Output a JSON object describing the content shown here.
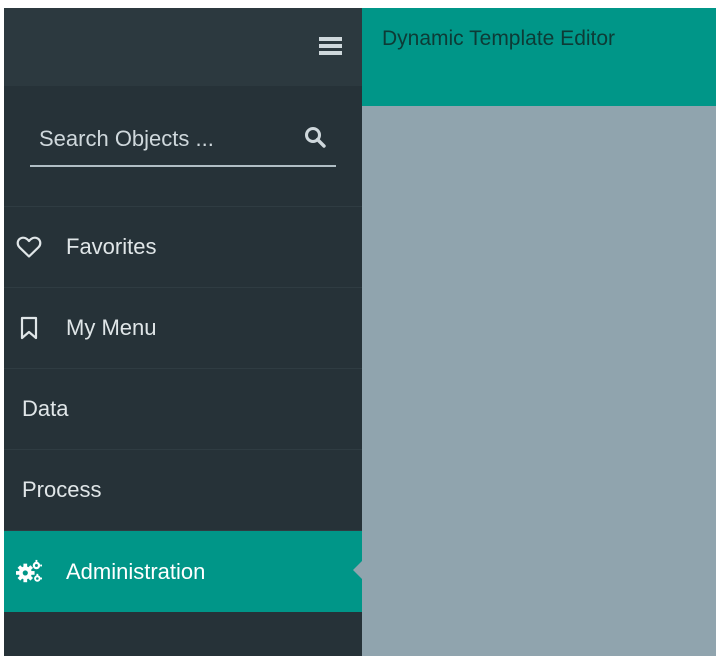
{
  "sidebar": {
    "search": {
      "placeholder": "Search Objects ..."
    },
    "items": [
      {
        "label": "Favorites",
        "icon": "heart-outline-icon"
      },
      {
        "label": "My Menu",
        "icon": "bookmark-outline-icon"
      },
      {
        "label": "Data"
      },
      {
        "label": "Process"
      },
      {
        "label": "Administration",
        "icon": "gears-icon",
        "active": true
      }
    ]
  },
  "main": {
    "title": "Dynamic Template Editor"
  },
  "colors": {
    "sidebar_bg": "#263238",
    "sidebar_header_bg": "#2c393f",
    "accent": "#009688",
    "content_bg": "#90a4ae",
    "title_text": "#0d3b36"
  }
}
